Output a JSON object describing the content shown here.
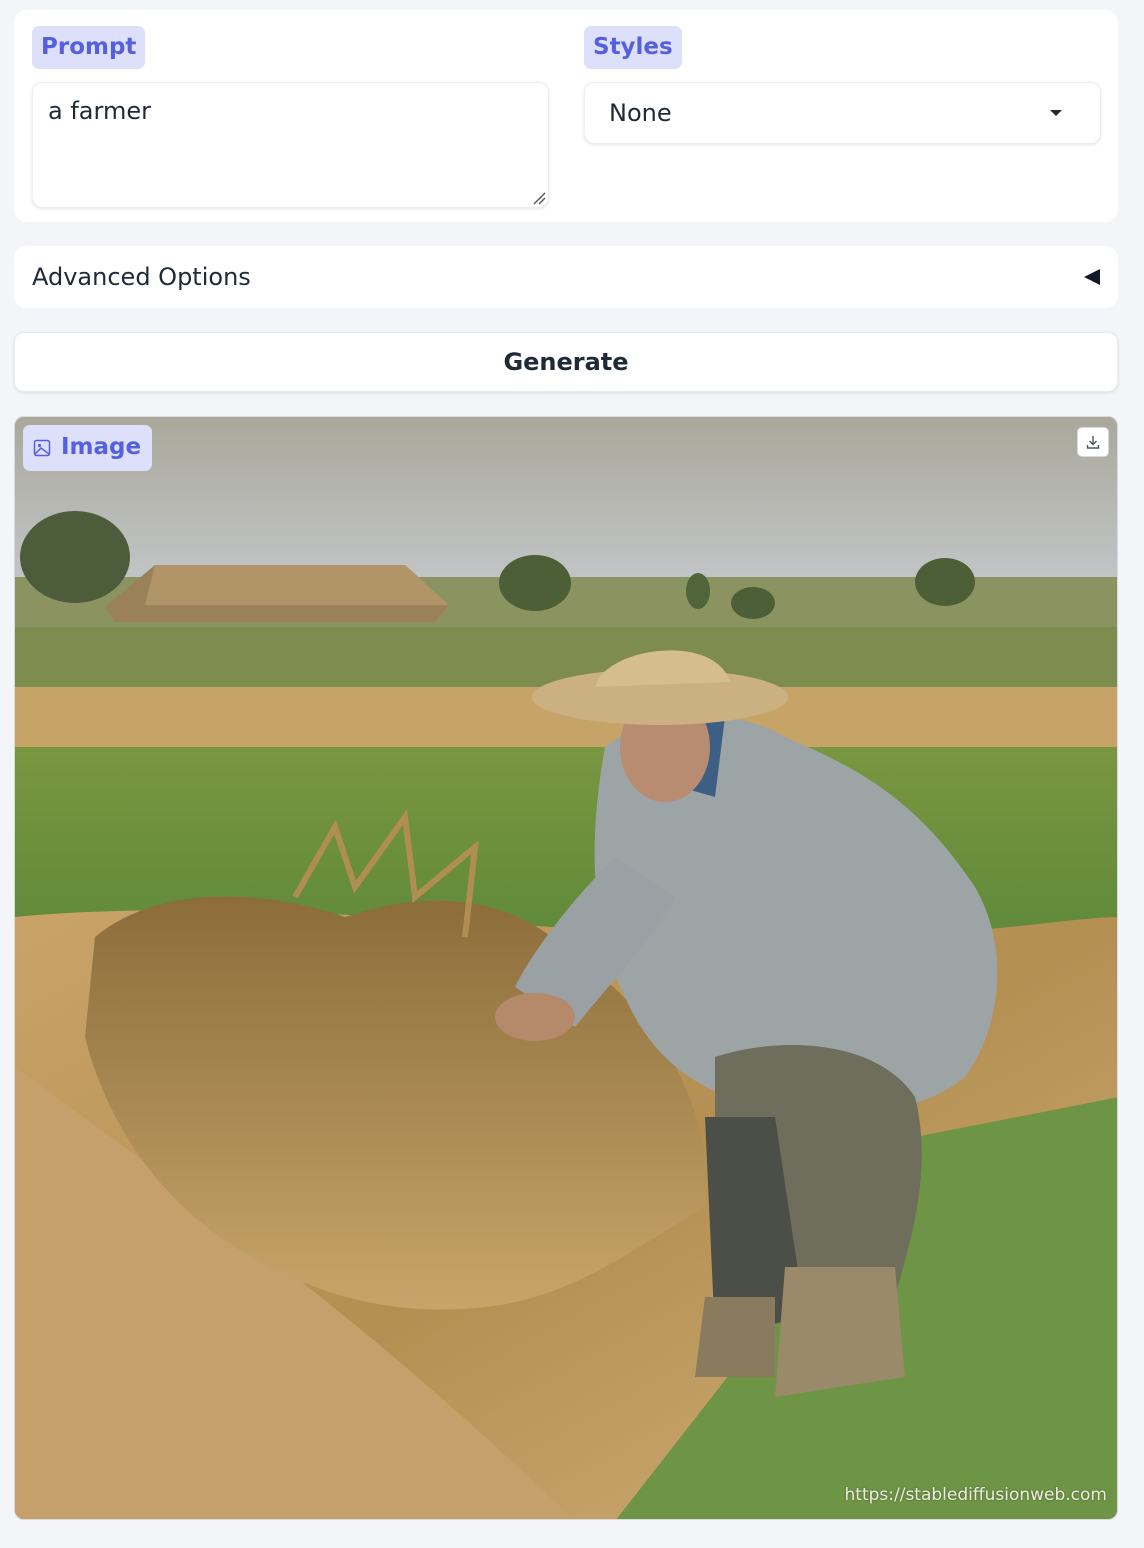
{
  "prompt": {
    "label": "Prompt",
    "value": "a farmer"
  },
  "styles": {
    "label": "Styles",
    "selected": "None"
  },
  "advanced_options": {
    "label": "Advanced Options",
    "state": "collapsed"
  },
  "generate": {
    "label": "Generate"
  },
  "output_image": {
    "label": "Image",
    "watermark": "https://stablediffusionweb.com",
    "icons": [
      "image-icon",
      "download-icon"
    ]
  },
  "colors": {
    "accent": "#5560e0",
    "badge_bg": "#dde0fb",
    "page_bg": "#f4f5f8"
  }
}
